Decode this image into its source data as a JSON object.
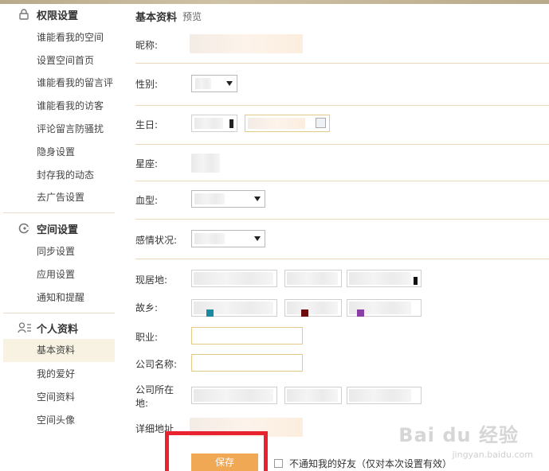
{
  "sidebar": {
    "sections": [
      {
        "title": "权限设置",
        "icon": "lock-icon",
        "items": [
          "谁能看我的空间",
          "设置空间首页",
          "谁能看我的留言评",
          "谁能看我的访客",
          "评论留言防骚扰",
          "隐身设置",
          "封存我的动态",
          "去广告设置"
        ]
      },
      {
        "title": "空间设置",
        "icon": "settings-icon",
        "items": [
          "同步设置",
          "应用设置",
          "通知和提醒"
        ]
      },
      {
        "title": "个人资料",
        "icon": "profile-icon",
        "items": [
          "基本资料",
          "我的爱好",
          "空间资料",
          "空间头像"
        ],
        "active_index": 0
      }
    ]
  },
  "main": {
    "tab_title": "基本资料",
    "tab_preview": "预览",
    "fields": {
      "nickname": "昵称:",
      "gender": "性别:",
      "birthday": "生日:",
      "constellation": "星座:",
      "blood": "血型:",
      "relationship": "感情状况:",
      "residence": "现居地:",
      "hometown": "故乡:",
      "job": "职业:",
      "company": "公司名称:",
      "company_addr": "公司所在地:",
      "detail_addr": "详细地址"
    },
    "save_label": "保存",
    "notify_label": "不通知我的好友（仅对本次设置有效）"
  },
  "watermark": {
    "brand": "Bai du 经验",
    "sub": "jingyan.baidu.com"
  }
}
